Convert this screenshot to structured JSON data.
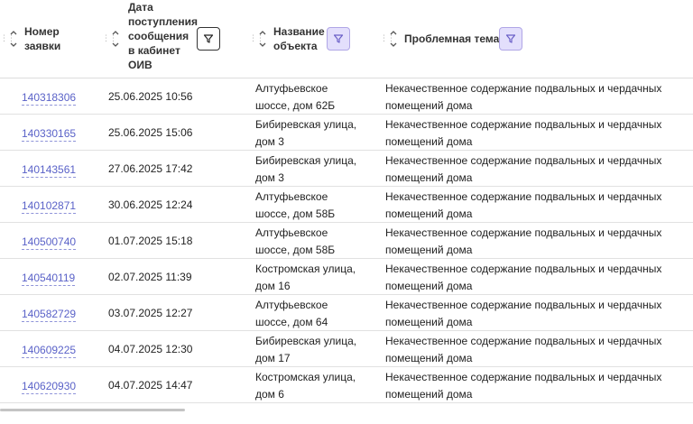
{
  "table": {
    "columns": [
      {
        "label": "Номер заявки",
        "lines": [
          "Номер",
          "заявки"
        ],
        "has_filter": false
      },
      {
        "label": "Дата поступления сообщения в кабинет ОИВ",
        "lines": [
          "Дата",
          "поступления",
          "сообщения",
          "в кабинет",
          "ОИВ"
        ],
        "has_filter": true,
        "filter_active": false
      },
      {
        "label": "Название объекта",
        "lines": [
          "Название",
          "объекта"
        ],
        "has_filter": true,
        "filter_active": true
      },
      {
        "label": "Проблемная тема",
        "lines": [
          "Проблемная тема"
        ],
        "has_filter": true,
        "filter_active": true
      }
    ],
    "rows": [
      {
        "id": "140318306",
        "date": "25.06.2025 10:56",
        "object": "Алтуфьевское шоссе, дом 62Б",
        "topic": "Некачественное содержание подвальных и чердачных помещений дома"
      },
      {
        "id": "140330165",
        "date": "25.06.2025 15:06",
        "object": "Бибиревская улица, дом 3",
        "topic": "Некачественное содержание подвальных и чердачных помещений дома"
      },
      {
        "id": "140143561",
        "date": "27.06.2025 17:42",
        "object": "Бибиревская улица, дом 3",
        "topic": "Некачественное содержание подвальных и чердачных помещений дома"
      },
      {
        "id": "140102871",
        "date": "30.06.2025 12:24",
        "object": "Алтуфьевское шоссе, дом 58Б",
        "topic": "Некачественное содержание подвальных и чердачных помещений дома"
      },
      {
        "id": "140500740",
        "date": "01.07.2025 15:18",
        "object": "Алтуфьевское шоссе, дом 58Б",
        "topic": "Некачественное содержание подвальных и чердачных помещений дома"
      },
      {
        "id": "140540119",
        "date": "02.07.2025 11:39",
        "object": "Костромская улица, дом 16",
        "topic": "Некачественное содержание подвальных и чердачных помещений дома"
      },
      {
        "id": "140582729",
        "date": "03.07.2025 12:27",
        "object": "Алтуфьевское шоссе, дом 64",
        "topic": "Некачественное содержание подвальных и чердачных помещений дома"
      },
      {
        "id": "140609225",
        "date": "04.07.2025 12:30",
        "object": "Бибиревская улица, дом 17",
        "topic": "Некачественное содержание подвальных и чердачных помещений дома"
      },
      {
        "id": "140620930",
        "date": "04.07.2025 14:47",
        "object": "Костромская улица, дом 6",
        "topic": "Некачественное содержание подвальных и чердачных помещений дома"
      }
    ]
  },
  "colors": {
    "link": "#5a62c8",
    "filter_active_bg": "#e3dffc",
    "filter_active_border": "#b0a6e6",
    "divider": "#e1e1e1"
  },
  "icons": {
    "drag": "drag-handle-icon",
    "sort": "sort-arrows-icon",
    "filter": "filter-icon"
  }
}
